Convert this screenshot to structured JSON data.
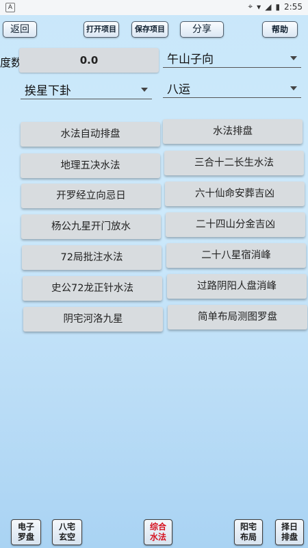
{
  "status_bar": {
    "app_badge": "A",
    "time": "2:55"
  },
  "toolbar": {
    "back": "返回",
    "open_project": "打开项目",
    "save_project": "保存项目",
    "share": "分享",
    "help": "帮助"
  },
  "degree": {
    "label": "度数",
    "value": "0.0"
  },
  "selects": {
    "direction": "午山子向",
    "star_mode": "挨星下卦",
    "period": "八运"
  },
  "grid": [
    "水法自动排盘",
    "水法排盘",
    "地理五决水法",
    "三合十二长生水法",
    "开罗经立向忌日",
    "六十仙命安葬吉凶",
    "杨公九星开门放水",
    "二十四山分金吉凶",
    "72局批注水法",
    "二十八星宿消峰",
    "史公72龙正针水法",
    "过路阴阳人盘消峰",
    "阴宅河洛九星",
    "简单布局测图罗盘"
  ],
  "bottom_nav": [
    {
      "line1": "电子",
      "line2": "罗盘"
    },
    {
      "line1": "八宅",
      "line2": "玄空"
    },
    {
      "line1": "综合",
      "line2": "水法",
      "active": true
    },
    {
      "line1": "阳宅",
      "line2": "布局"
    },
    {
      "line1": "择日",
      "line2": "排盘"
    }
  ],
  "colors": {
    "active_text": "#d6121f",
    "background": "#c9e7fa"
  }
}
